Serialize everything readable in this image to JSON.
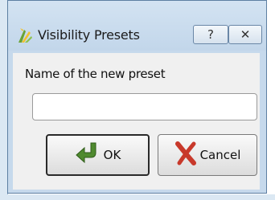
{
  "window": {
    "title": "Visibility Presets",
    "help_label": "?",
    "close_label": "✕"
  },
  "form": {
    "name_label": "Name of the new preset",
    "name_value": "",
    "name_placeholder": ""
  },
  "buttons": {
    "ok_label": "OK",
    "cancel_label": "Cancel"
  },
  "colors": {
    "ok_icon": "#4f8a2f",
    "cancel_icon": "#c8392b"
  },
  "icons": {
    "app": "qgis-icon",
    "help": "help-icon",
    "close": "close-icon",
    "ok": "ok-arrow-icon",
    "cancel": "cancel-x-icon"
  }
}
